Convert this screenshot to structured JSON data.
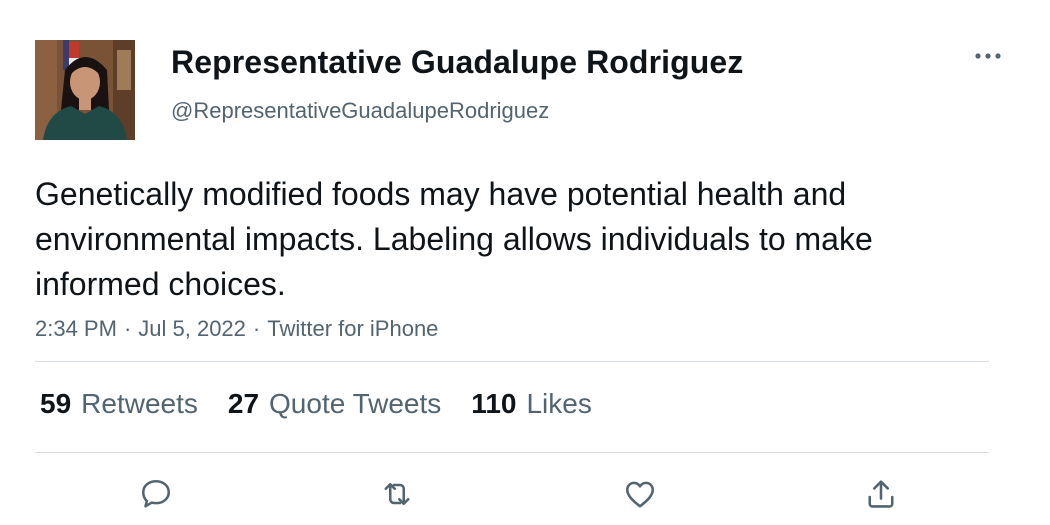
{
  "author": {
    "display_name": "Representative Guadalupe Rodriguez",
    "handle": "@RepresentativeGuadalupeRodriguez",
    "avatar_icon": "profile-photo"
  },
  "tweet": {
    "text": "Genetically modified foods may have potential health and environmental impacts. Labeling allows individuals to make informed choices.",
    "time": "2:34 PM",
    "separator": "·",
    "date": "Jul 5, 2022",
    "source": "Twitter for iPhone"
  },
  "stats": {
    "retweets": {
      "count": "59",
      "label": "Retweets"
    },
    "quote_tweets": {
      "count": "27",
      "label": "Quote Tweets"
    },
    "likes": {
      "count": "110",
      "label": "Likes"
    }
  },
  "actions": {
    "reply_icon": "reply-icon",
    "retweet_icon": "retweet-icon",
    "like_icon": "heart-icon",
    "share_icon": "share-icon",
    "more_icon": "more-horizontal-icon"
  },
  "colors": {
    "text_primary": "#0f1419",
    "text_secondary": "#536471",
    "divider": "#d8dde1",
    "background": "#ffffff"
  }
}
